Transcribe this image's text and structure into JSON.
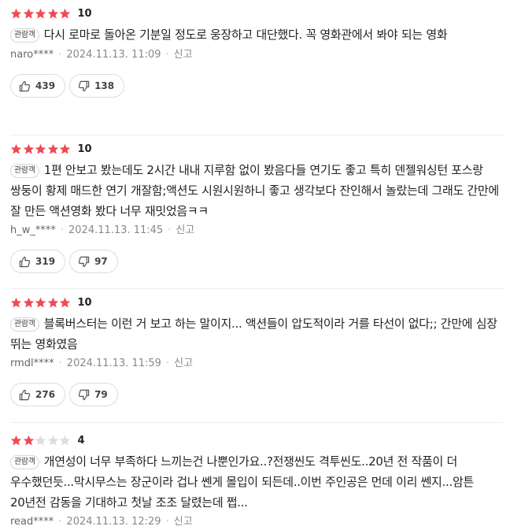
{
  "colors": {
    "star_on": "#f04a55",
    "star_off": "#dddddd"
  },
  "reviews": [
    {
      "stars_filled": 5,
      "score": "10",
      "badge": "관람객",
      "text": "다시 로마로 돌아온 기분일 정도로 웅장하고 대단했다. 꼭 영화관에서 봐야 되는 영화",
      "user": "naro****",
      "date": "2024.11.13. 11:09",
      "report": "신고",
      "likes": "439",
      "dislikes": "138"
    },
    {
      "stars_filled": 5,
      "score": "10",
      "badge": "관람객",
      "text": "1편 안보고 봤는데도 2시간 내내 지루함 없이 봤음다들 연기도 좋고 특히 덴젤워싱턴 포스랑 쌍둥이 황제 매드한 연기 개잘함;액션도 시원시원하니 좋고 생각보다 잔인해서 놀랐는데 그래도 간만에 잘 만든 액션영화 봤다 너무 재밋었음ㅋㅋ",
      "user": "h_w_****",
      "date": "2024.11.13. 11:45",
      "report": "신고",
      "likes": "319",
      "dislikes": "97"
    },
    {
      "stars_filled": 5,
      "score": "10",
      "badge": "관람객",
      "text": "블록버스터는 이런 거 보고 하는 말이지... 액션들이 압도적이라 거를 타선이 없다;; 간만에 심장 뛰는 영화였음",
      "user": "rmdl****",
      "date": "2024.11.13. 11:59",
      "report": "신고",
      "likes": "276",
      "dislikes": "79"
    },
    {
      "stars_filled": 2,
      "score": "4",
      "badge": "관람객",
      "text": "개연성이 너무 부족하다 느끼는건 나뿐인가요..?전쟁씬도 격투씬도..20년 전 작품이 더 우수했던듯...막시무스는 장군이라 겁나 쎈게 몰입이 되든데..이번 주인공은 먼데 이리 쎈지...암튼 20년전 감동을 기대하고 첫날 조조 달렸는데 쩝...",
      "user": "read****",
      "date": "2024.11.13. 12:29",
      "report": "신고",
      "likes": "",
      "dislikes": ""
    }
  ],
  "icons": {
    "like": "thumbs-up-icon",
    "dislike": "thumbs-down-icon",
    "star": "star-icon"
  }
}
